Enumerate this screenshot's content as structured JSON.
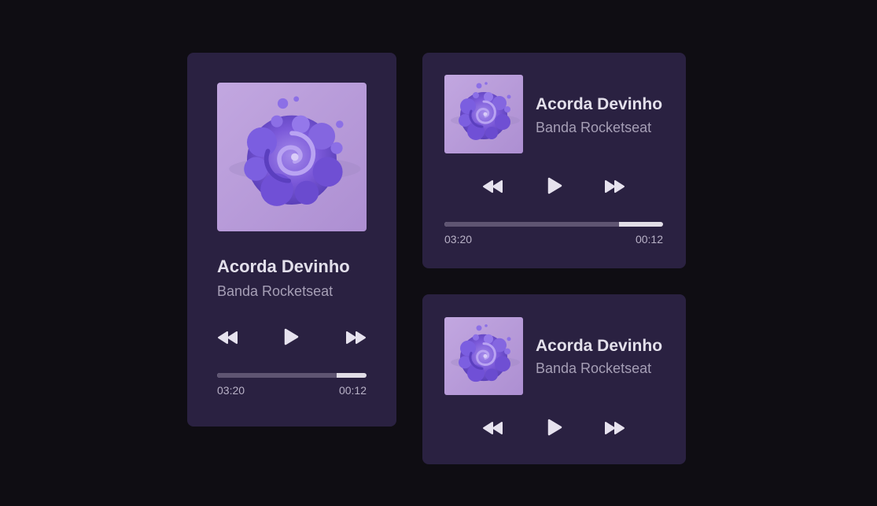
{
  "players": [
    {
      "title": "Acorda Devinho",
      "artist": "Banda Rocketseat",
      "progress": 0.8,
      "time_elapsed": "03:20",
      "time_remaining": "00:12"
    },
    {
      "title": "Acorda Devinho",
      "artist": "Banda Rocketseat",
      "progress": 0.8,
      "time_elapsed": "03:20",
      "time_remaining": "00:12"
    },
    {
      "title": "Acorda Devinho",
      "artist": "Banda Rocketseat"
    }
  ],
  "icons": {
    "cover": "album-cover-purple-spiral",
    "rewind": "rewind-icon",
    "play": "play-icon",
    "forward": "fast-forward-icon"
  },
  "colors": {
    "background": "#0f0d13",
    "card": "#2a2141",
    "title": "#e3e0eb",
    "artist": "#a69fb6",
    "cover_bg": "#b89ad8",
    "cover_blob": "#7b59d9",
    "progress_track": "#e1dde6",
    "progress_fill": "#5f5572"
  }
}
